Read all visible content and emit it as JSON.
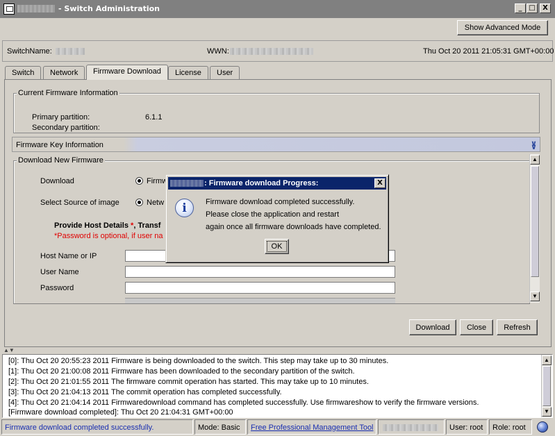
{
  "window": {
    "title": "- Switch Administration",
    "controls": {
      "minimize": "_",
      "maximize": "□",
      "close": "X"
    }
  },
  "toolbar": {
    "advanced_mode_label": "Show Advanced Mode"
  },
  "header": {
    "switchname_label": "SwitchName:",
    "wwn_label": "WWN:",
    "datetime": "Thu Oct 20 2011 21:05:31 GMT+00:00"
  },
  "tabs": [
    {
      "label": "Switch"
    },
    {
      "label": "Network"
    },
    {
      "label": "Firmware Download",
      "active": true
    },
    {
      "label": "License"
    },
    {
      "label": "User"
    }
  ],
  "current_fw": {
    "title": "Current Firmware Information",
    "primary_label": "Primary partition:",
    "primary_value": "6.1.1",
    "secondary_label": "Secondary partition:",
    "secondary_value": ""
  },
  "fw_key": {
    "title": "Firmware Key Information",
    "toggle_icon": "double-chevron-down-icon"
  },
  "download_new": {
    "title": "Download New Firmware",
    "download_label": "Download",
    "download_option": "Firmw",
    "source_label": "Select Source of image",
    "source_option": "Netw",
    "host_details_heading": "Provide Host Details ",
    "host_details_star": "*",
    "host_details_rest": ", Transf",
    "password_note": "*Password is optional, if user na",
    "host_label": "Host Name or IP",
    "user_label": "User Name",
    "password_label": "Password",
    "host_value": "",
    "user_value": "",
    "password_value": ""
  },
  "actions": {
    "download": "Download",
    "close": "Close",
    "refresh": "Refresh"
  },
  "log": [
    "[0]: Thu Oct 20 20:55:23 2011 Firmware is being downloaded to the switch. This step may take up to 30 minutes.",
    "[1]: Thu Oct 20 21:00:08 2011 Firmware has been downloaded to the secondary partition of the switch.",
    "[2]: Thu Oct 20 21:01:55 2011 The firmware commit operation has started. This may take up to 10 minutes.",
    "[3]: Thu Oct 20 21:04:13 2011 The commit operation has completed successfully.",
    "[4]: Thu Oct 20 21:04:14 2011 Firmwaredownload command has completed successfully. Use firmwareshow to verify the firmware versions.",
    "[Firmware download completed]: Thu Oct 20 21:04:31 GMT+00:00"
  ],
  "status": {
    "message": "Firmware download completed successfully.",
    "mode": "Mode: Basic",
    "link": "Free Professional Management Tool",
    "user": "User: root",
    "role": "Role: root"
  },
  "dialog": {
    "title": ": Firmware download Progress:",
    "icon": "info-icon",
    "line1": "Firmware download completed successfully.",
    "line2": "Please close the application and restart",
    "line3": "again once all firmware downloads have completed.",
    "ok_label": "OK",
    "close_glyph": "X"
  },
  "colors": {
    "titlebar": "#808080",
    "dialog_title": "#0a246a",
    "status_message": "#1a2fb0",
    "required": "#e00000"
  }
}
